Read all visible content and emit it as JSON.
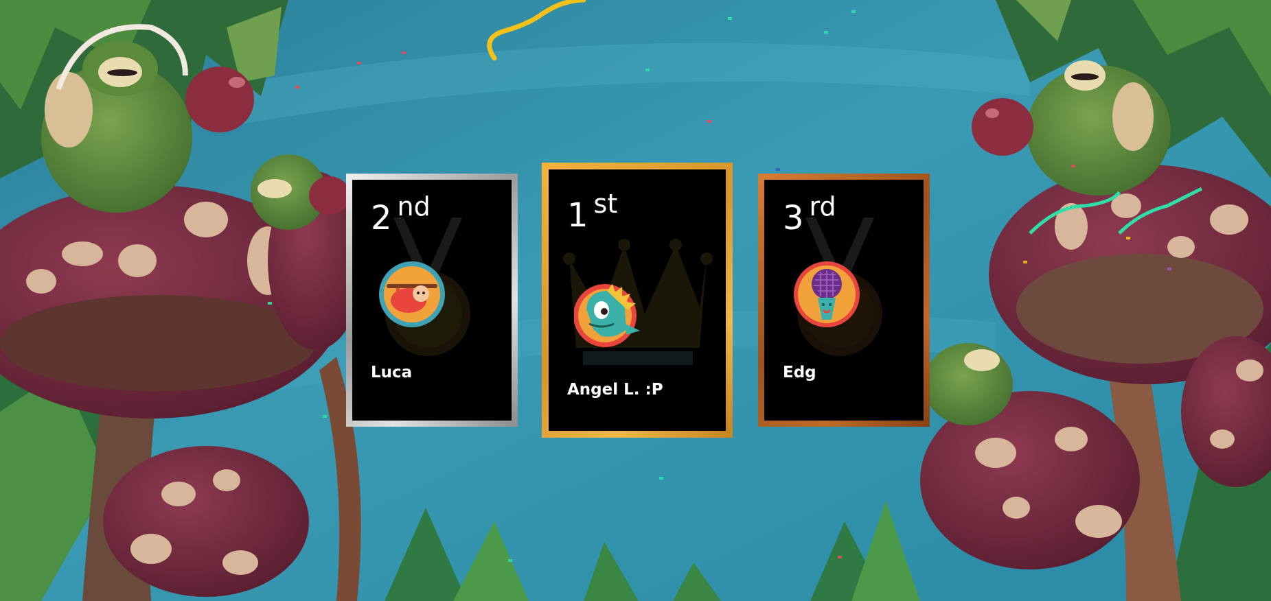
{
  "podium": [
    {
      "place": "2",
      "suffix": "nd",
      "name": "Luca",
      "avatar": "sloth-icon",
      "tier": "silver"
    },
    {
      "place": "1",
      "suffix": "st",
      "name": "Angel L. :P",
      "avatar": "dinosaur-icon",
      "tier": "gold"
    },
    {
      "place": "3",
      "suffix": "rd",
      "name": "Edg",
      "avatar": "microphone-icon",
      "tier": "bronze"
    }
  ],
  "colors": {
    "gold": "#e2a33a",
    "silver": "#c9c9c9",
    "bronze": "#b86a2b",
    "background": "#2f8ea6"
  }
}
